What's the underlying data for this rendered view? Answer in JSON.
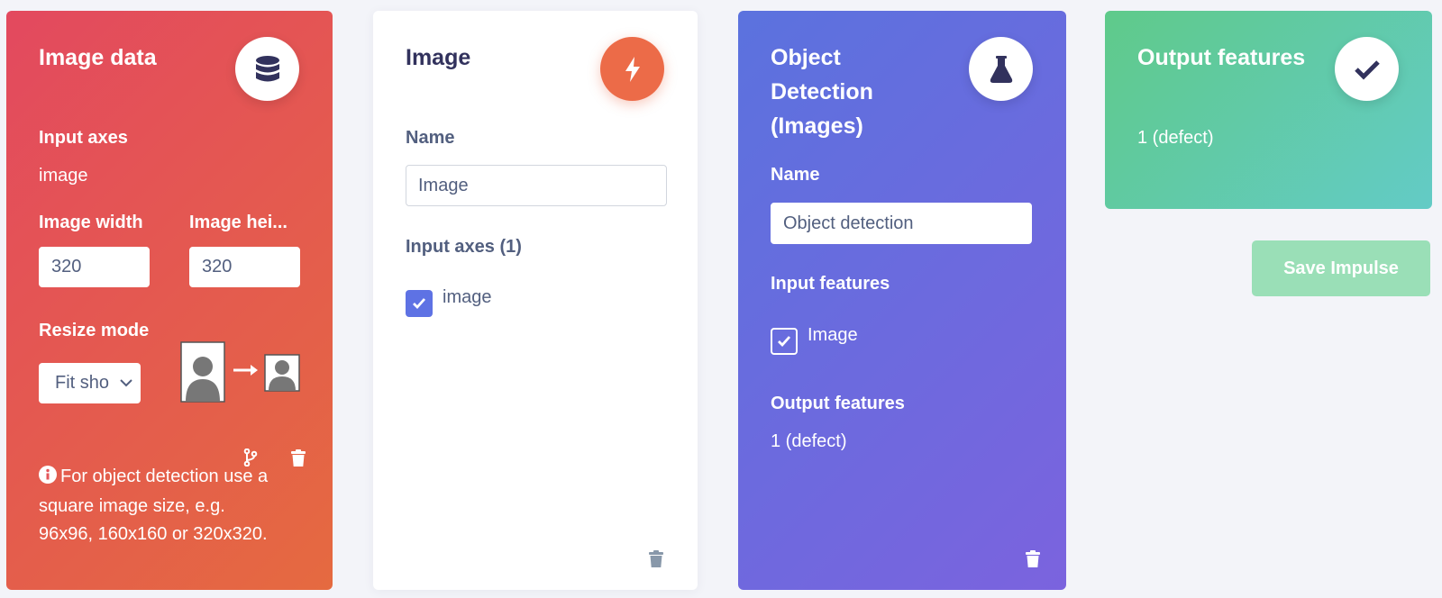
{
  "input_block": {
    "title": "Image data",
    "icon": "database-icon",
    "input_axes_label": "Input axes",
    "input_axes_value": "image",
    "width_label": "Image width",
    "width_value": "320",
    "height_label": "Image hei...",
    "height_value": "320",
    "resize_label": "Resize mode",
    "resize_value": "Fit sho",
    "info_text": "For object detection use a square image size, e.g. 96x96, 160x160 or 320x320."
  },
  "processing_block": {
    "title": "Image",
    "icon": "bolt-icon",
    "name_label": "Name",
    "name_value": "Image",
    "input_axes_label": "Input axes (1)",
    "axes": [
      {
        "label": "image",
        "checked": true
      }
    ]
  },
  "learn_block": {
    "title": "Object Detection (Images)",
    "icon": "flask-icon",
    "name_label": "Name",
    "name_value": "Object detection",
    "input_features_label": "Input features",
    "features": [
      {
        "label": "Image",
        "checked": true
      }
    ],
    "output_features_label": "Output features",
    "output_features_value": "1 (defect)"
  },
  "output_block": {
    "title": "Output features",
    "icon": "check-icon",
    "value": "1 (defect)"
  },
  "save_button": "Save Impulse",
  "colors": {
    "input_gradient": [
      "#e3495f",
      "#e56a40"
    ],
    "learn_gradient": [
      "#5b72de",
      "#7b63de"
    ],
    "output_gradient": [
      "#5fca8a",
      "#63cbc6"
    ],
    "accent": "#5e72e4",
    "processing_icon_bg": "#ec6b48"
  }
}
